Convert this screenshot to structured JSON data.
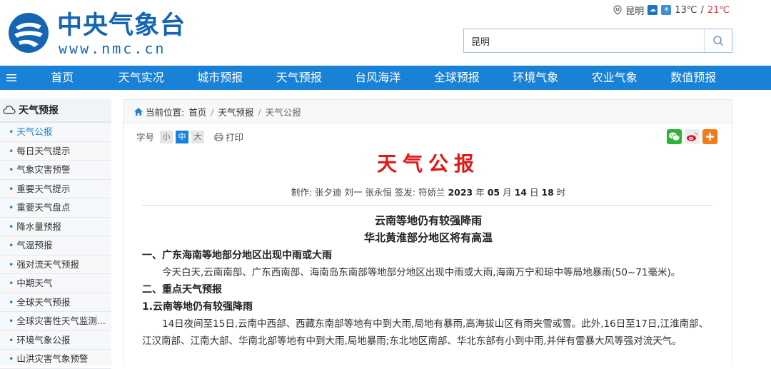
{
  "header": {
    "logo_title": "中央气象台",
    "logo_url": "www.nmc.cn",
    "location": "昆明",
    "temp_low": "13℃",
    "temp_separator": "/",
    "temp_high": "21℃",
    "search_value": "昆明"
  },
  "nav": {
    "items": [
      "首页",
      "天气实况",
      "城市预报",
      "天气预报",
      "台风海洋",
      "全球预报",
      "环境气象",
      "农业气象",
      "数值预报"
    ]
  },
  "sidebar": {
    "title": "天气预报",
    "items": [
      "天气公报",
      "每日天气提示",
      "气象灾害预警",
      "重要天气提示",
      "重要天气盘点",
      "降水量预报",
      "气温预报",
      "强对流天气预报",
      "中期天气",
      "全球天气预报",
      "全球灾害性天气监测...",
      "环境气象公报",
      "山洪灾害气象预警"
    ]
  },
  "breadcrumb": {
    "prefix": "当前位置:",
    "items": [
      "首页",
      "天气预报",
      "天气公报"
    ]
  },
  "toolbar": {
    "font_label": "字号",
    "small": "小",
    "medium": "中",
    "large": "大",
    "print": "打印"
  },
  "doc": {
    "title": "天气公报",
    "meta_prefix": "制作: 张夕迪 刘一 张永恒  签发: 符娇兰 ",
    "year": "2023",
    "year_unit": " 年 ",
    "month": "05",
    "month_unit": " 月 ",
    "day": "14",
    "day_unit": " 日 ",
    "hour": "18",
    "hour_unit": " 时",
    "headline1": "云南等地仍有较强降雨",
    "headline2": "华北黄淮部分地区将有高温",
    "sec1": "一、广东海南等地部分地区出现中雨或大雨",
    "para1": "今天白天,云南南部、广东西南部、海南岛东南部等地部分地区出现中雨或大雨,海南万宁和琼中等局地暴雨(50~71毫米)。",
    "sec2": "二、重点天气预报",
    "sec2_1": "1.云南等地仍有较强降雨",
    "para2": "14日夜间至15日,云南中西部、西藏东南部等地有中到大雨,局地有暴雨,高海拔山区有雨夹雪或雪。此外,16日至17日,江淮南部、江汉南部、江南大部、华南北部等地有中到大雨,局地暴雨;东北地区南部、华北东部有小到中雨,并伴有雷暴大风等强对流天气。"
  },
  "colors": {
    "brand_blue": "#1a82d6",
    "logo_blue": "#1565b3",
    "title_red": "#e01818",
    "temp_high_red": "#e53935"
  },
  "icons": [
    "location-pin-icon",
    "weather-cloud-icon",
    "weather-sun-cloud-icon",
    "search-icon",
    "menu-icon",
    "cloud-outline-icon",
    "home-icon",
    "print-icon",
    "wechat-icon",
    "weibo-icon",
    "plus-share-icon"
  ]
}
